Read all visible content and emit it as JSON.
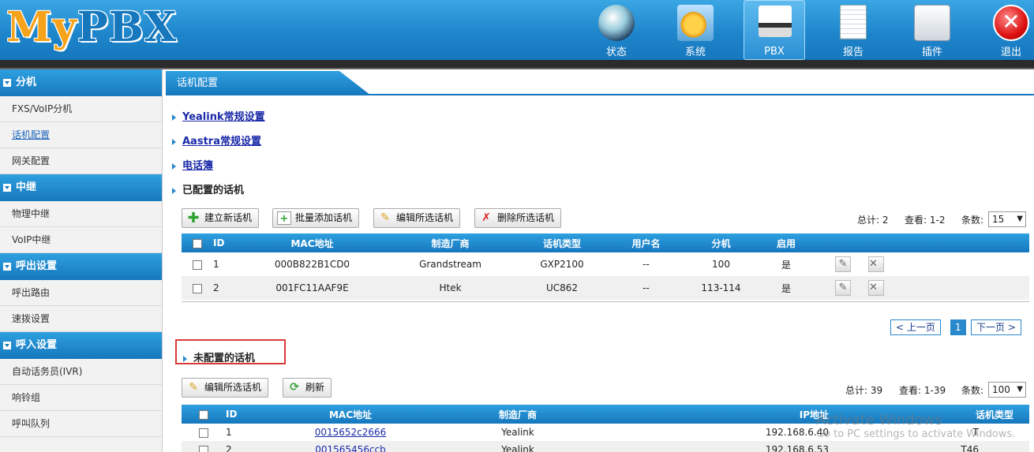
{
  "header": {
    "logo_left": "My",
    "logo_right": "PBX",
    "nav": [
      {
        "label": "状态",
        "icon": "status-icon"
      },
      {
        "label": "系统",
        "icon": "system-icon"
      },
      {
        "label": "PBX",
        "icon": "pbx-phone-icon"
      },
      {
        "label": "报告",
        "icon": "report-icon"
      },
      {
        "label": "插件",
        "icon": "plugin-icon"
      },
      {
        "label": "退出",
        "icon": "logout-icon"
      }
    ]
  },
  "sidebar": {
    "sections": [
      {
        "title": "分机",
        "items": [
          "FXS/VoIP分机",
          "话机配置",
          "网关配置"
        ]
      },
      {
        "title": "中继",
        "items": [
          "物理中继",
          "VoIP中继"
        ]
      },
      {
        "title": "呼出设置",
        "items": [
          "呼出路由",
          "速拨设置"
        ]
      },
      {
        "title": "呼入设置",
        "items": [
          "自动话务员(IVR)",
          "响铃组",
          "呼叫队列"
        ]
      }
    ],
    "active_item": "话机配置"
  },
  "main": {
    "tab_title": "话机配置",
    "links": {
      "yealink": "Yealink常规设置",
      "aastra": "Aastra常规设置",
      "phonebook": "电话簿"
    },
    "configured_title": "已配置的话机",
    "configured_buttons": {
      "new": "建立新话机",
      "batch_add": "批量添加话机",
      "edit": "编辑所选话机",
      "delete": "删除所选话机"
    },
    "configured_stats": {
      "total": "总计: 2",
      "view": "查看: 1-2",
      "count_label": "条数:",
      "count_value": "15"
    },
    "configured_columns": [
      "ID",
      "MAC地址",
      "制造厂商",
      "话机类型",
      "用户名",
      "分机",
      "启用"
    ],
    "configured_rows": [
      {
        "id": "1",
        "mac": "000B822B1CD0",
        "vendor": "Grandstream",
        "type": "GXP2100",
        "user": "--",
        "ext": "100",
        "enabled": "是"
      },
      {
        "id": "2",
        "mac": "001FC11AAF9E",
        "vendor": "Htek",
        "type": "UC862",
        "user": "--",
        "ext": "113-114",
        "enabled": "是"
      }
    ],
    "pager": {
      "prev": "< 上一页",
      "current": "1",
      "next": "下一页 >"
    },
    "unconfigured_title": "未配置的话机",
    "unconfigured_buttons": {
      "edit": "编辑所选话机",
      "refresh": "刷新"
    },
    "unconfigured_stats": {
      "total": "总计: 39",
      "view": "查看: 1-39",
      "count_label": "条数:",
      "count_value": "100"
    },
    "unconfigured_columns": [
      "ID",
      "MAC地址",
      "制造厂商",
      "IP地址",
      "话机类型"
    ],
    "unconfigured_rows": [
      {
        "id": "1",
        "mac": "0015652c2666",
        "vendor": "Yealink",
        "ip": "192.168.6.40",
        "type": "T"
      },
      {
        "id": "2",
        "mac": "001565456ccb",
        "vendor": "Yealink",
        "ip": "192.168.6.53",
        "type": "T46"
      }
    ]
  },
  "watermark": {
    "line1": "Activate Windows",
    "line2": "Go to PC settings to activate Windows."
  },
  "colors": {
    "header_blue": "#1f86cc",
    "logo_orange": "#f6a21a",
    "highlight_red": "#d93a3a"
  }
}
